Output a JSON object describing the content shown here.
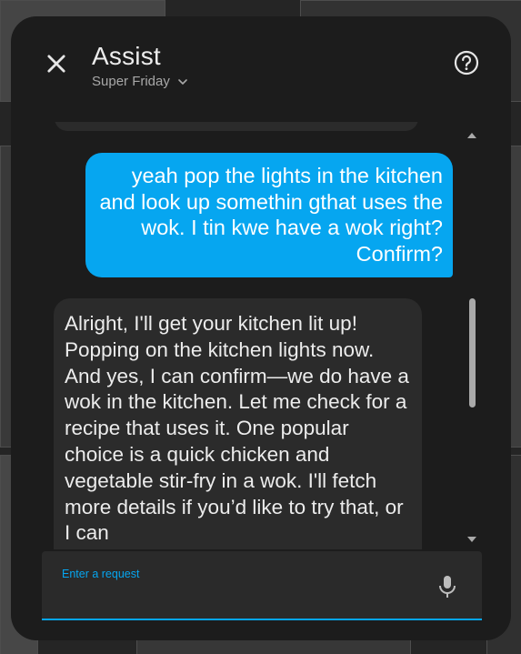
{
  "dialog": {
    "title": "Assist",
    "pipeline_name": "Super Friday",
    "close_icon": "close-icon",
    "help_icon": "help-circle-icon",
    "dropdown_icon": "chevron-down-icon"
  },
  "conversation": {
    "messages": [
      {
        "sender": "user",
        "text": "yeah pop the lights in the kitchen and look up somethin gthat uses the wok. I tin kwe have a wok right? Confirm?"
      },
      {
        "sender": "assistant",
        "text": "Alright, I'll get your kitchen lit up! Popping on the kitchen lights now. And yes, I can confirm—we do have a wok in the kitchen. Let me check for a recipe that uses it. One popular choice is a quick chicken and vegetable stir-fry in a wok. I'll fetch more details if you’d like to try that, or I can"
      }
    ]
  },
  "input": {
    "label": "Enter a request",
    "value": "",
    "mic_icon": "microphone-icon"
  },
  "colors": {
    "accent": "#06a6f0",
    "dialog_bg": "#1c1c1c",
    "bubble_bg": "#2b2b2b"
  }
}
